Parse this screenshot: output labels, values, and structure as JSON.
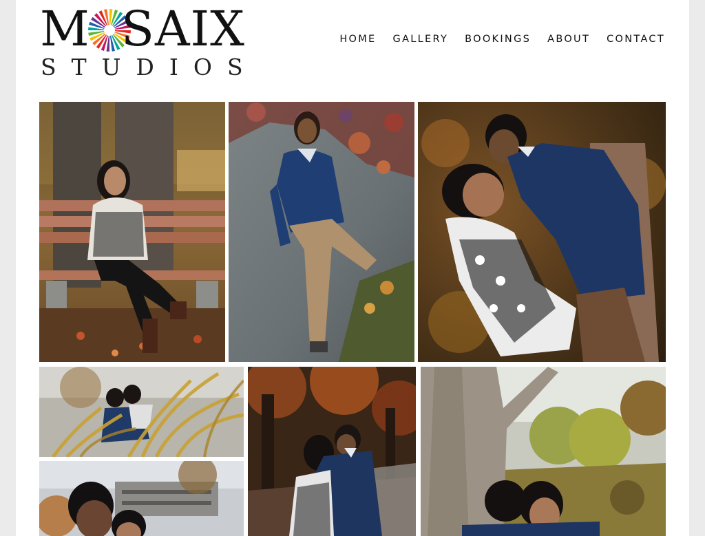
{
  "brand": {
    "logo_top_first": "M",
    "logo_top_rest": "SAIX",
    "logo_bottom": "STUDIOS",
    "burst_colors": [
      "#e52420",
      "#f37021",
      "#f9c000",
      "#5cb531",
      "#00a5a1",
      "#1f5fac",
      "#6a3293",
      "#c2185b"
    ]
  },
  "nav": {
    "items": [
      {
        "label": "HOME"
      },
      {
        "label": "GALLERY"
      },
      {
        "label": "BOOKINGS"
      },
      {
        "label": "ABOUT"
      },
      {
        "label": "CONTACT"
      }
    ]
  },
  "gallery": {
    "photos": [
      {
        "subject": "woman-on-bench"
      },
      {
        "subject": "man-against-wall"
      },
      {
        "subject": "couple-embrace-closeup"
      },
      {
        "subject": "couple-through-grass"
      },
      {
        "subject": "couple-hug-path"
      },
      {
        "subject": "couple-under-tree"
      },
      {
        "subject": "couple-closeup-buildings"
      }
    ]
  }
}
